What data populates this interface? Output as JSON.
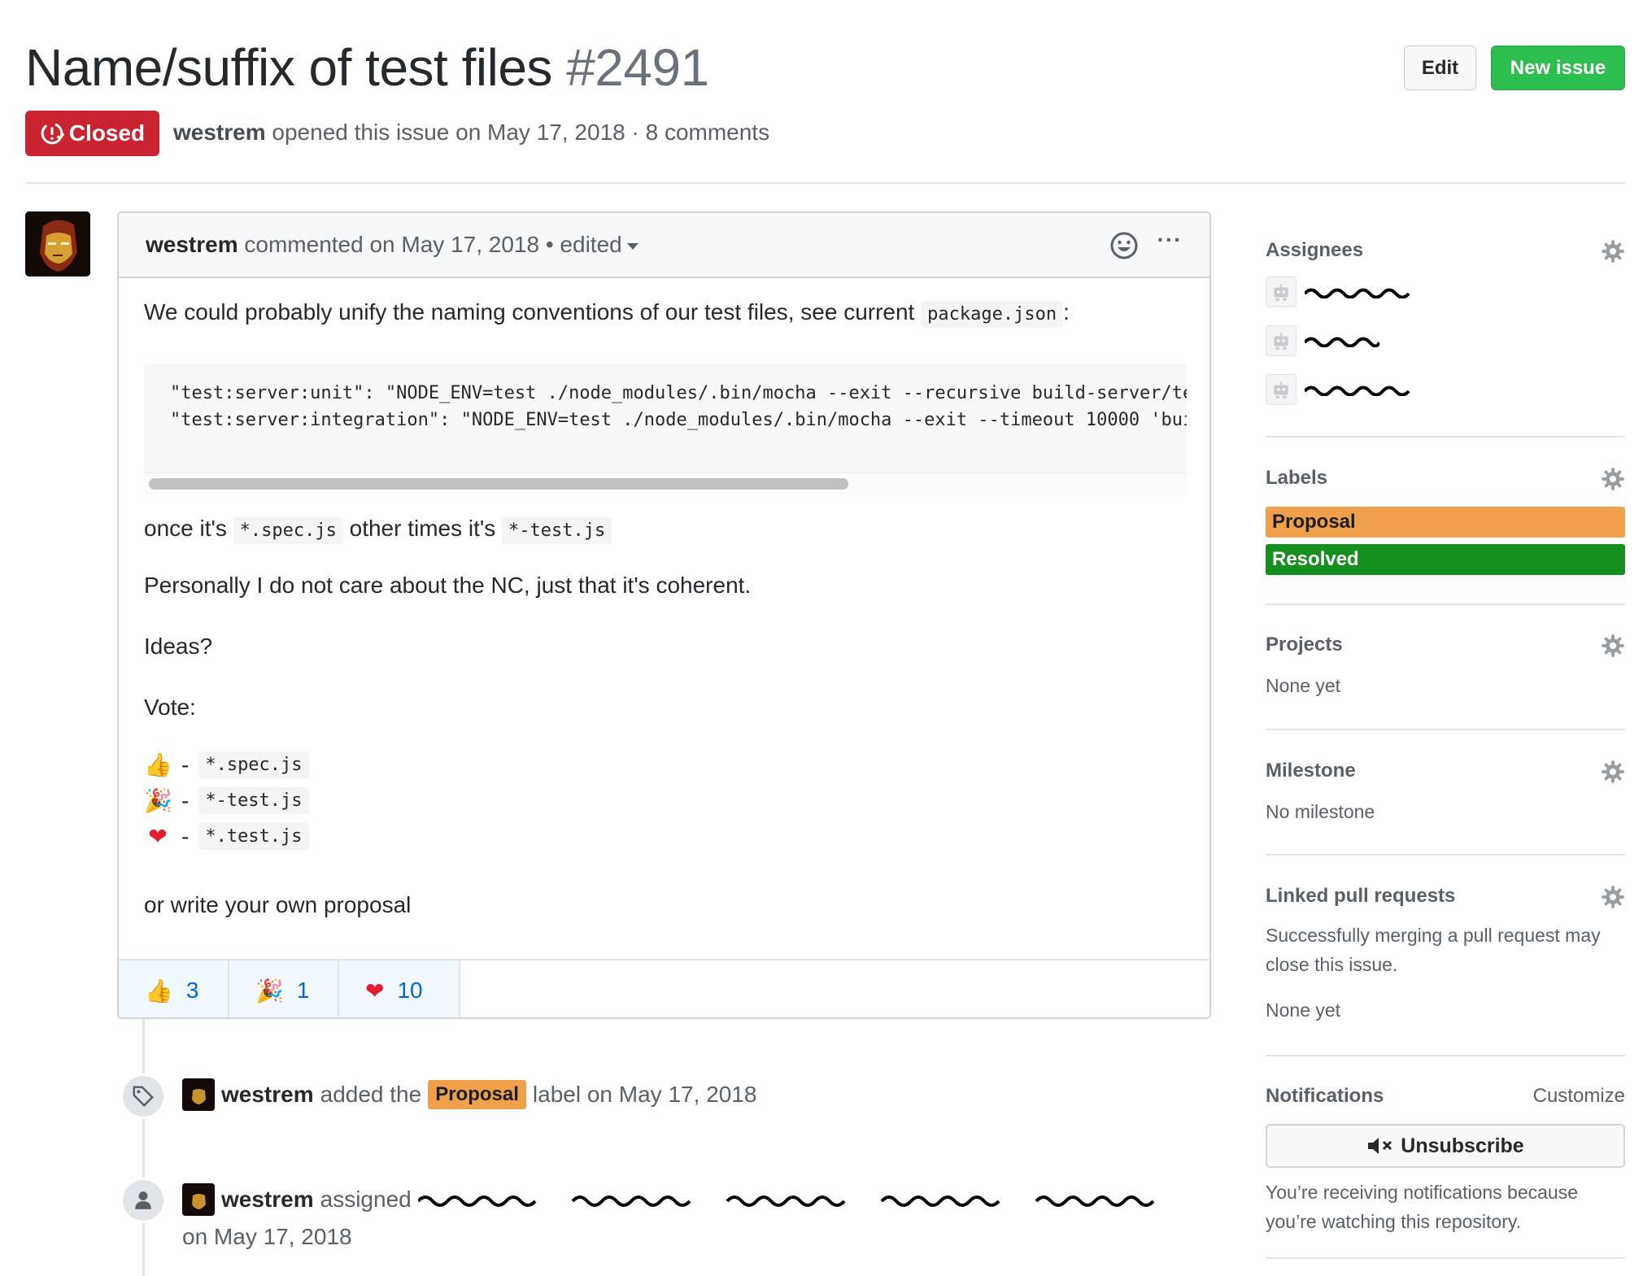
{
  "issue": {
    "title": "Name/suffix of test files",
    "number": "#2491",
    "state": "Closed",
    "author": "westrem",
    "opened_text": "opened this issue on May 17, 2018 · 8 comments"
  },
  "header_buttons": {
    "edit": "Edit",
    "new_issue": "New issue"
  },
  "comment": {
    "author": "westrem",
    "meta": "commented on May 17, 2018 • edited",
    "intro_text": "We could probably unify the naming conventions of our test files, see current",
    "intro_code": "package.json",
    "intro_suffix": ":",
    "code_lines": [
      "\"test:server:unit\": \"NODE_ENV=test ./node_modules/.bin/mocha --exit --recursive build-server/te",
      "\"test:server:integration\": \"NODE_ENV=test ./node_modules/.bin/mocha --exit --timeout 10000 'bui"
    ],
    "once_text": "once it's",
    "once_code": "*.spec.js",
    "other_text": "other times it's",
    "other_code": "*-test.js",
    "personally": "Personally I do not care about the NC, just that it's coherent.",
    "ideas": "Ideas?",
    "vote": "Vote:",
    "vote_options": [
      {
        "emoji": "👍",
        "dash": "-",
        "code": "*.spec.js"
      },
      {
        "emoji": "🎉",
        "dash": "-",
        "code": "*-test.js"
      },
      {
        "emoji": "❤",
        "dash": "-",
        "code": "*.test.js"
      }
    ],
    "closing": "or write your own proposal"
  },
  "reactions": [
    {
      "emoji": "👍",
      "count": "3"
    },
    {
      "emoji": "🎉",
      "count": "1"
    },
    {
      "emoji": "❤",
      "count": "10"
    }
  ],
  "events": {
    "label_event": {
      "actor": "westrem",
      "pre": "added the",
      "label": "Proposal",
      "post": "label on May 17, 2018"
    },
    "assign_event": {
      "actor": "westrem",
      "verb": "assigned",
      "date": "on May 17, 2018"
    }
  },
  "sidebar": {
    "assignees_title": "Assignees",
    "labels_title": "Labels",
    "labels": [
      {
        "name": "Proposal",
        "color": "#f0a04b",
        "text_color": "#1b1f23"
      },
      {
        "name": "Resolved",
        "color": "#15901f",
        "text_color": "#ffffff"
      }
    ],
    "projects_title": "Projects",
    "projects_value": "None yet",
    "milestone_title": "Milestone",
    "milestone_value": "No milestone",
    "linked_title": "Linked pull requests",
    "linked_desc": "Successfully merging a pull request may close this issue.",
    "linked_value": "None yet",
    "notifications_title": "Notifications",
    "customize": "Customize",
    "unsubscribe": "Unsubscribe",
    "notify_reason": "You’re receiving notifications because you’re watching this repository."
  },
  "colors": {
    "closed": "#cb2431",
    "new_issue": "#2cbe4e",
    "link": "#0366d6"
  },
  "icons": [
    "issue-closed-icon",
    "smiley-icon",
    "kebab-icon",
    "tag-icon",
    "person-icon",
    "gear-icon",
    "bot-avatar-icon",
    "mute-icon"
  ]
}
